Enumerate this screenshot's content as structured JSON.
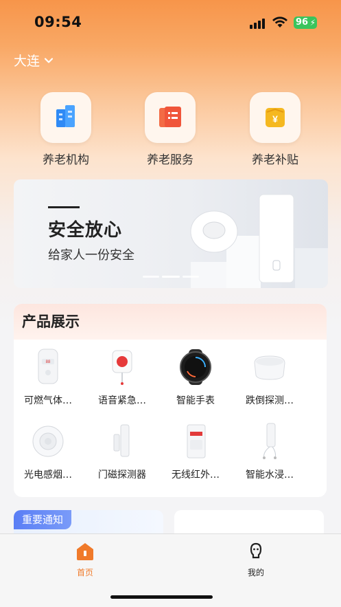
{
  "status": {
    "time": "09:54",
    "battery": "96"
  },
  "location": {
    "city": "大连"
  },
  "quick_actions": [
    {
      "label": "养老机构",
      "icon": "building-icon",
      "color": "#2f8af5"
    },
    {
      "label": "养老服务",
      "icon": "service-list-icon",
      "color": "#f0553a"
    },
    {
      "label": "养老补贴",
      "icon": "subsidy-yuan-icon",
      "color": "#f5b820"
    }
  ],
  "banner": {
    "title": "安全放心",
    "subtitle": "给家人一份安全"
  },
  "products": {
    "title": "产品展示",
    "items": [
      {
        "name": "可燃气体…",
        "icon": "gas-detector-icon"
      },
      {
        "name": "语音紧急…",
        "icon": "emergency-button-icon"
      },
      {
        "name": "智能手表",
        "icon": "smart-watch-icon"
      },
      {
        "name": "跌倒探测…",
        "icon": "fall-detector-icon"
      },
      {
        "name": "光电感烟…",
        "icon": "smoke-detector-icon"
      },
      {
        "name": "门磁探测器",
        "icon": "door-sensor-icon"
      },
      {
        "name": "无线红外…",
        "icon": "infrared-sensor-icon"
      },
      {
        "name": "智能水浸…",
        "icon": "water-sensor-icon"
      }
    ]
  },
  "notice": {
    "tag": "重要通知"
  },
  "tabbar": {
    "home_label": "首页",
    "mine_label": "我的",
    "active_color": "#f07a2a"
  }
}
